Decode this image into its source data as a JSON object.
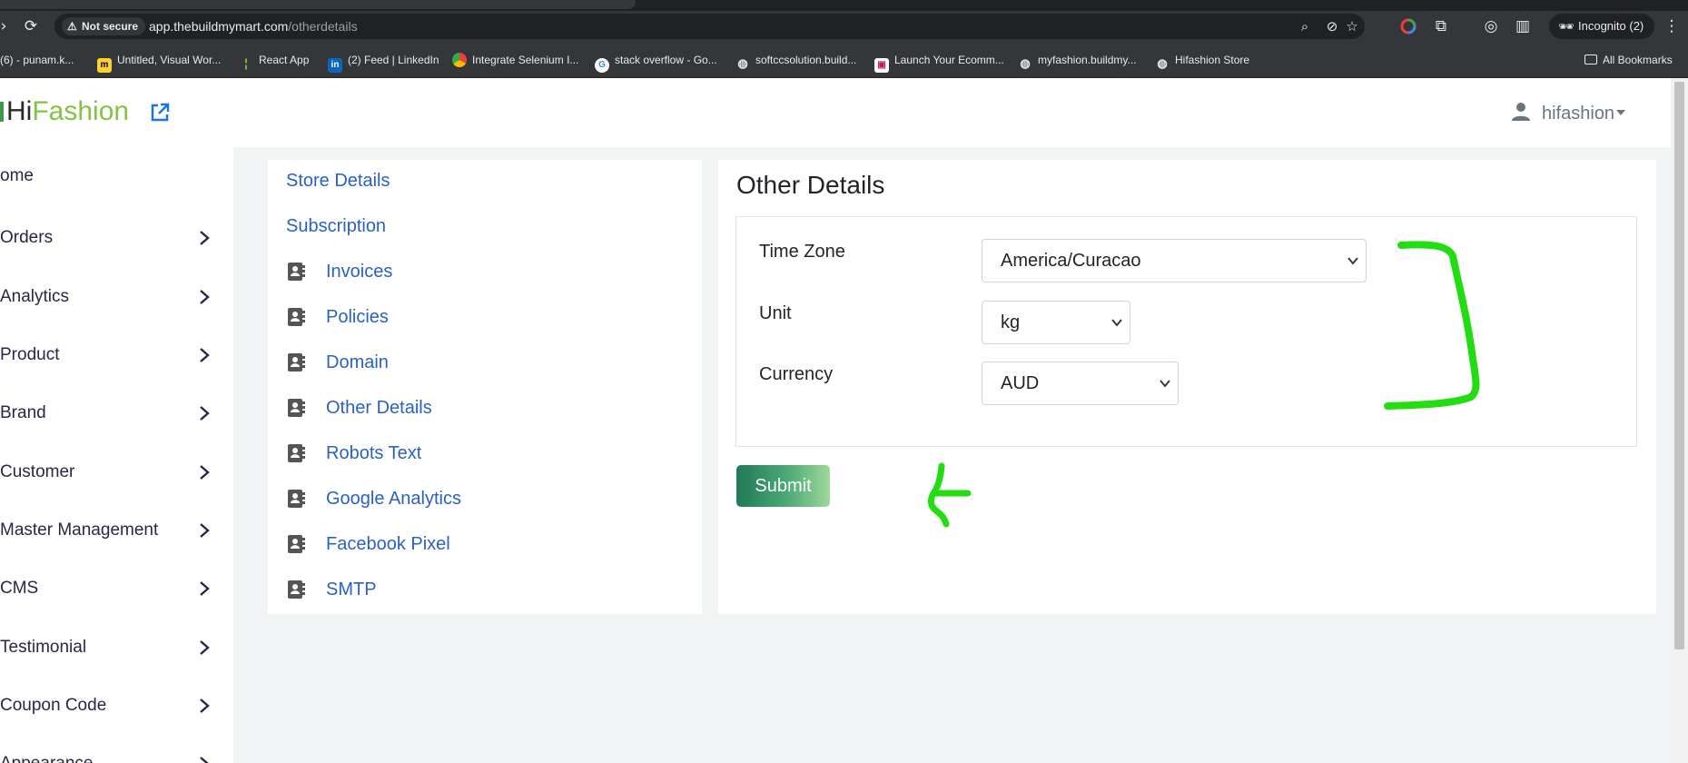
{
  "browser": {
    "not_secure_label": "Not secure",
    "url_host": "app.thebuildmymart.com",
    "url_path": "/otherdetails",
    "incognito_label": "Incognito (2)",
    "all_bookmarks_label": "All Bookmarks",
    "bookmarks": [
      {
        "label": "(6) - punam.k...",
        "icon": "generic"
      },
      {
        "label": "Untitled, Visual Wor...",
        "icon": "miro"
      },
      {
        "label": "React App",
        "icon": "react"
      },
      {
        "label": "(2) Feed | LinkedIn",
        "icon": "linkedin"
      },
      {
        "label": "Integrate Selenium I...",
        "icon": "chrome"
      },
      {
        "label": "stack overflow - Go...",
        "icon": "google"
      },
      {
        "label": "softccsolution.build...",
        "icon": "globe"
      },
      {
        "label": "Launch Your Ecomm...",
        "icon": "store"
      },
      {
        "label": "myfashion.buildmy...",
        "icon": "globe"
      },
      {
        "label": "Hifashion Store",
        "icon": "globe"
      }
    ]
  },
  "header": {
    "brand_hi": "Hi",
    "brand_fashion": "Fashion",
    "user_name": "hifashion"
  },
  "sidebar": {
    "items": [
      {
        "label": "ome",
        "has_chevron": false
      },
      {
        "label": "Orders",
        "has_chevron": true
      },
      {
        "label": "Analytics",
        "has_chevron": true
      },
      {
        "label": "Product",
        "has_chevron": true
      },
      {
        "label": "Brand",
        "has_chevron": true
      },
      {
        "label": "Customer",
        "has_chevron": true
      },
      {
        "label": "Master Management",
        "has_chevron": true
      },
      {
        "label": "CMS",
        "has_chevron": true
      },
      {
        "label": "Testimonial",
        "has_chevron": true
      },
      {
        "label": "Coupon Code",
        "has_chevron": true
      },
      {
        "label": "Appearance",
        "has_chevron": true
      }
    ]
  },
  "settings_nav": {
    "plain_links": [
      "Store Details",
      "Subscription"
    ],
    "icon_links": [
      "Invoices",
      "Policies",
      "Domain",
      "Other Details",
      "Robots Text",
      "Google Analytics",
      "Facebook Pixel",
      "SMTP"
    ]
  },
  "main": {
    "title": "Other Details",
    "fields": {
      "timezone_label": "Time Zone",
      "timezone_value": "America/Curacao",
      "unit_label": "Unit",
      "unit_value": "kg",
      "currency_label": "Currency",
      "currency_value": "AUD"
    },
    "submit_label": "Submit"
  },
  "colors": {
    "accent_link": "#2a61c4",
    "brand_green": "#84c341",
    "annotation_green": "#22dd11"
  }
}
